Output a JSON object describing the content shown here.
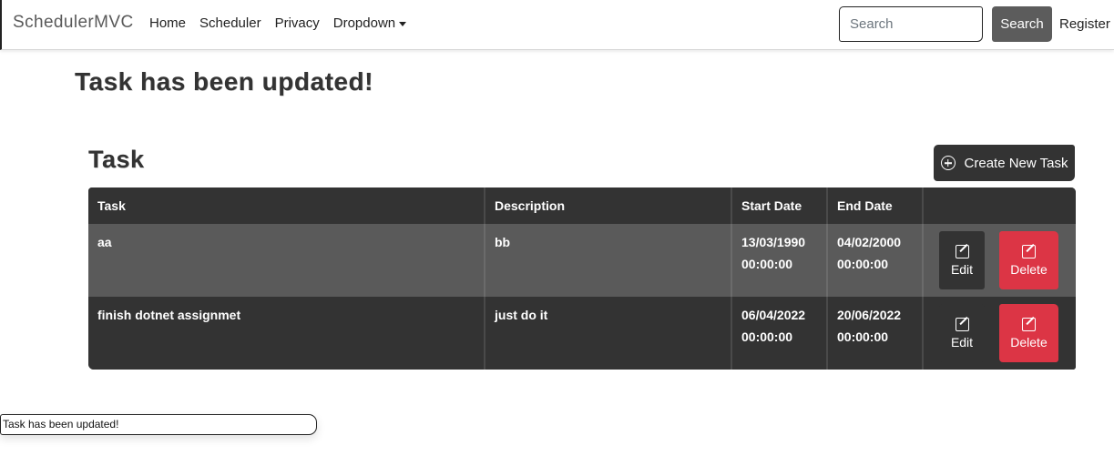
{
  "navbar": {
    "brand": "SchedulerMVC",
    "links": [
      "Home",
      "Scheduler",
      "Privacy",
      "Dropdown"
    ],
    "search_placeholder": "Search",
    "search_button": "Search",
    "register": "Register"
  },
  "update_message": "Task has been updated!",
  "section": {
    "title": "Task",
    "create_button": "Create New Task"
  },
  "table": {
    "headers": [
      "Task",
      "Description",
      "Start Date",
      "End Date",
      ""
    ],
    "rows": [
      {
        "task": "aa",
        "description": "bb",
        "start_date": "13/03/1990",
        "start_time": "00:00:00",
        "end_date": "04/02/2000",
        "end_time": "00:00:00",
        "edit_label": "Edit",
        "delete_label": "Delete"
      },
      {
        "task": "finish dotnet assignmet",
        "description": "just do it",
        "start_date": "06/04/2022",
        "start_time": "00:00:00",
        "end_date": "20/06/2022",
        "end_time": "00:00:00",
        "edit_label": "Edit",
        "delete_label": "Delete"
      }
    ]
  },
  "toast": {
    "message": "Task has been updated!"
  },
  "colors": {
    "dark": "#333333",
    "row_highlight": "#5a5a5a",
    "danger": "#dc3545",
    "search_button": "#5c5c5c"
  },
  "icons": {
    "create": "plus-circle-icon",
    "edit": "pencil-square-icon",
    "delete": "pencil-square-icon"
  }
}
